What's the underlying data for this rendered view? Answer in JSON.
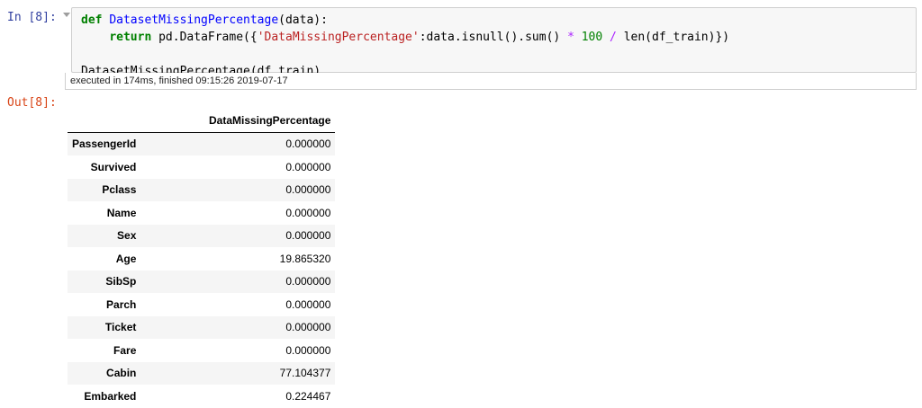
{
  "cell": {
    "in_prompt": "In [8]:",
    "out_prompt": "Out[8]:",
    "code": {
      "line1": {
        "kw": "def",
        "fn": "DatasetMissingPercentage",
        "rest": "(data):"
      },
      "line2": {
        "kw": "return",
        "a": " pd.DataFrame({",
        "str": "'DataMissingPercentage'",
        "b": ":data.isnull().sum() ",
        "op1": "*",
        "num": "100",
        "op2": "/",
        "c": " len(df_train)})"
      },
      "line4": "DatasetMissingPercentage(df_train)"
    },
    "execution_info": "executed in 174ms, finished 09:15:26 2019-07-17"
  },
  "output_table": {
    "column_header": "DataMissingPercentage",
    "rows": [
      {
        "index": "PassengerId",
        "value": "0.000000"
      },
      {
        "index": "Survived",
        "value": "0.000000"
      },
      {
        "index": "Pclass",
        "value": "0.000000"
      },
      {
        "index": "Name",
        "value": "0.000000"
      },
      {
        "index": "Sex",
        "value": "0.000000"
      },
      {
        "index": "Age",
        "value": "19.865320"
      },
      {
        "index": "SibSp",
        "value": "0.000000"
      },
      {
        "index": "Parch",
        "value": "0.000000"
      },
      {
        "index": "Ticket",
        "value": "0.000000"
      },
      {
        "index": "Fare",
        "value": "0.000000"
      },
      {
        "index": "Cabin",
        "value": "77.104377"
      },
      {
        "index": "Embarked",
        "value": "0.224467"
      }
    ]
  },
  "colors": {
    "in_prompt": "#303f9f",
    "out_prompt": "#d84315",
    "keyword": "#008000",
    "function_name": "#0000ff",
    "string": "#ba2121",
    "operator": "#aa22ff",
    "input_background": "#f7f7f7"
  },
  "icons": {
    "collapse_toggle": "caret-down-icon"
  }
}
